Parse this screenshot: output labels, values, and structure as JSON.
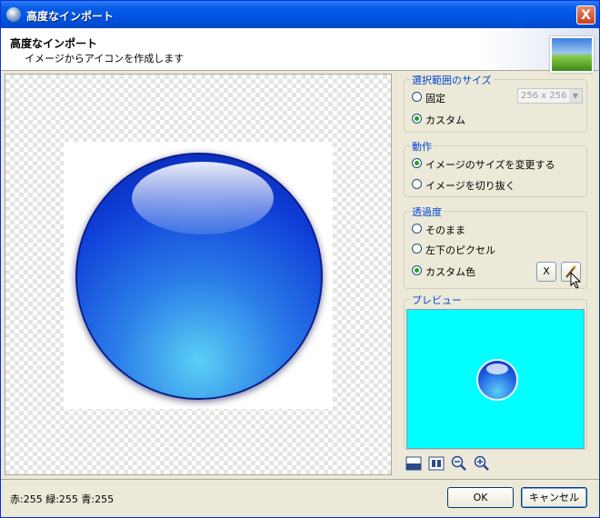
{
  "window": {
    "title": "高度なインポート",
    "close_glyph": "X"
  },
  "header": {
    "title": "高度なインポート",
    "subtitle": "イメージからアイコンを作成します"
  },
  "selection_size": {
    "legend": "選択範囲のサイズ",
    "options": [
      "固定",
      "カスタム"
    ],
    "selected": "カスタム",
    "size_value": "256 x 256"
  },
  "action": {
    "legend": "動作",
    "options": [
      "イメージのサイズを変更する",
      "イメージを切り抜く"
    ],
    "selected": "イメージのサイズを変更する"
  },
  "transparency": {
    "legend": "透過度",
    "options": [
      "そのまま",
      "左下のピクセル",
      "カスタム色"
    ],
    "selected": "カスタム色",
    "clear_button": "X"
  },
  "preview": {
    "legend": "プレビュー",
    "background_color": "#00ffff"
  },
  "toolbar": {
    "icons": [
      "checkerboard-icon",
      "fit-icon",
      "zoom-out-icon",
      "zoom-in-icon"
    ]
  },
  "status": {
    "text": "赤:255 緑:255 青:255"
  },
  "buttons": {
    "ok": "OK",
    "cancel": "キャンセル"
  },
  "colors": {
    "titlebar": "#0054e3",
    "legend_text": "#0046d5",
    "radio_selected": "#21a121"
  }
}
